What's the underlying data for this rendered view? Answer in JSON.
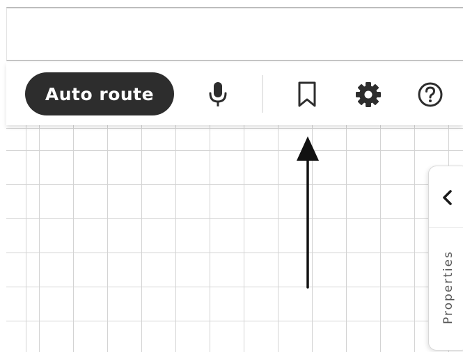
{
  "toolbar": {
    "auto_route_label": "Auto route",
    "icons": [
      "microphone-icon",
      "bookmark-icon",
      "gear-icon",
      "help-icon"
    ]
  },
  "properties_panel": {
    "tab_label": "Properties",
    "collapse_icon": "chevron-left-icon"
  },
  "annotation": {
    "arrow_icon": "arrow-up-icon"
  },
  "colors": {
    "button_bg": "#2d2d2d",
    "button_text": "#ffffff",
    "icon": "#2d2d2d",
    "grid_line": "#d3d3d3",
    "panel_text": "#555555"
  }
}
